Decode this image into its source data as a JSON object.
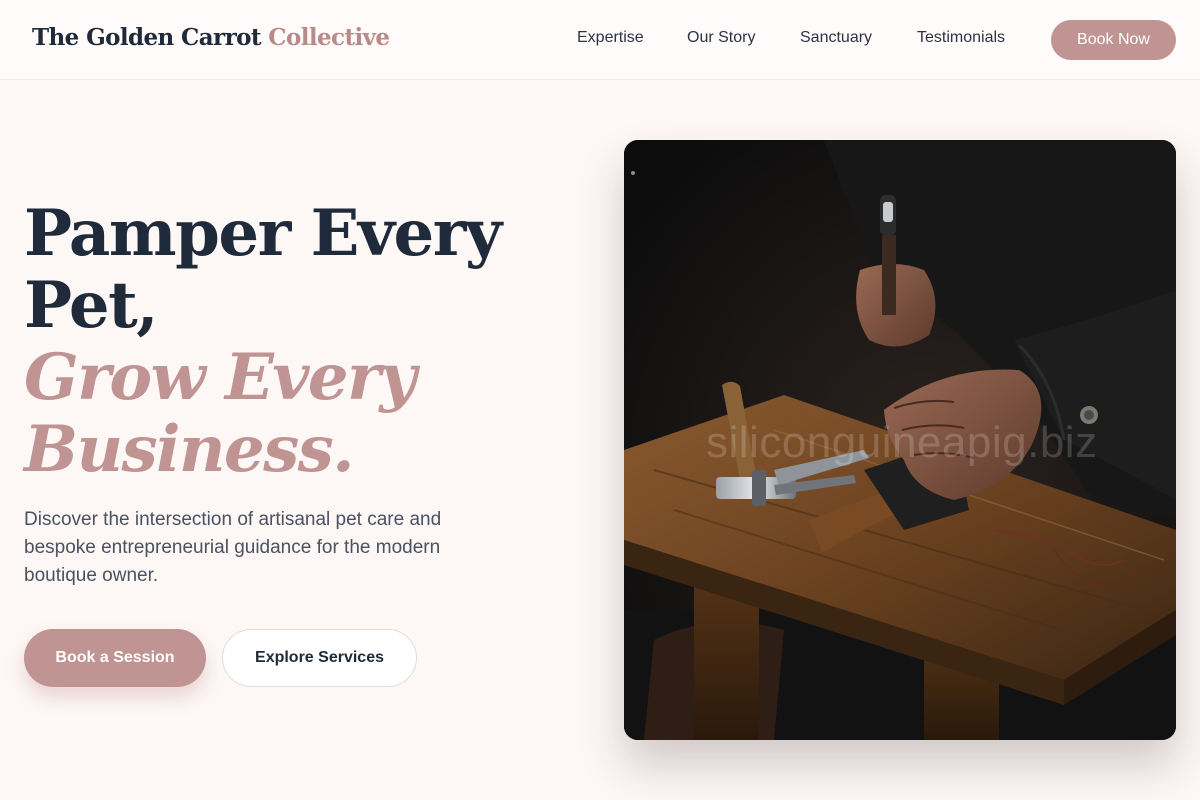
{
  "header": {
    "logo_main": "The Golden Carrot",
    "logo_accent": "Collective",
    "nav": [
      "Expertise",
      "Our Story",
      "Sanctuary",
      "Testimonials"
    ],
    "cta": "Book Now"
  },
  "hero": {
    "line1": "Pamper Every",
    "line2": "Pet,",
    "line3": "Grow Every",
    "line4": "Business.",
    "subtext": "Discover the intersection of artisanal pet care and bespoke entrepreneurial guidance for the modern boutique owner.",
    "primary_button": "Book a Session",
    "secondary_button": "Explore Services"
  },
  "image": {
    "watermark": "siliconguineapig.biz"
  },
  "colors": {
    "accent": "#c09492",
    "dark": "#1f2a3a",
    "background": "#fdf7f6"
  }
}
